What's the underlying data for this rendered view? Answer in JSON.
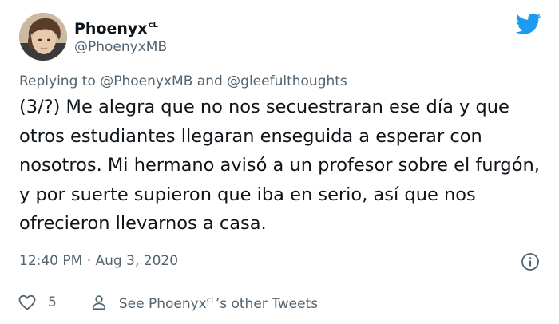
{
  "author": {
    "display_name": "Phoenyx",
    "name_superscript": "cL",
    "handle": "@PhoenyxMB",
    "avatar_icon": "avatar-photo"
  },
  "brand": {
    "icon": "twitter-bird-icon",
    "color": "#1d9bf0"
  },
  "reply": {
    "prefix": "Replying to",
    "mention_1": "@PhoenyxMB",
    "joiner": "and",
    "mention_2": "@gleefulthoughts"
  },
  "tweet": {
    "text": "(3/?) Me alegra que no nos secuestraran ese día y que otros estudiantes llegaran enseguida a esperar con nosotros. Mi hermano avisó a un profesor sobre el furgón, y por suerte supieron que iba en serio, así que nos ofrecieron llevarnos a casa."
  },
  "meta": {
    "timestamp": "12:40 PM · Aug 3, 2020",
    "info_icon": "info-icon"
  },
  "actions": {
    "like_count": "5",
    "see_more_prefix": "See Phoenyx",
    "see_more_superscript": "cL",
    "see_more_suffix": "’s other Tweets"
  },
  "colors": {
    "text_primary": "#0f1419",
    "text_secondary": "#536471",
    "divider": "#e6ecf0"
  }
}
